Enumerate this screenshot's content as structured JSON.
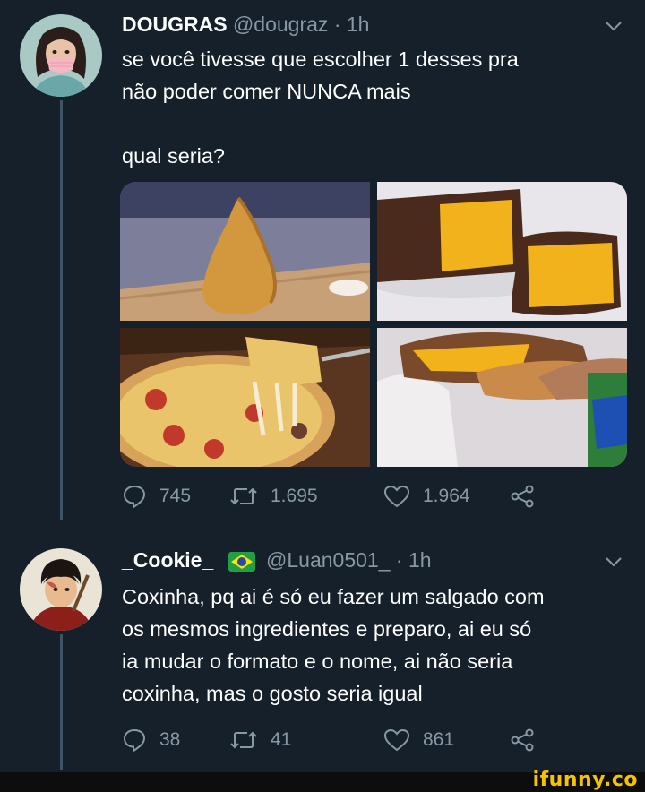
{
  "tweet1": {
    "name": "DOUGRAS",
    "handle": "@dougraz",
    "time": "· 1h",
    "lines": [
      "se você tivesse que escolher 1 desses pra",
      "não poder comer NUNCA mais",
      "",
      "qual seria?"
    ],
    "stats": {
      "replies": "745",
      "retweets": "1.695",
      "likes": "1.964"
    }
  },
  "tweet2": {
    "name": "_Cookie_",
    "handle": "@Luan0501_",
    "time": "· 1h",
    "flag": "brazil-flag",
    "lines": [
      "Coxinha, pq ai é só eu fazer um salgado com",
      "os mesmos ingredientes e preparo, ai eu só",
      "ia mudar o formato e o nome, ai não seria",
      "coxinha, mas o gosto seria igual"
    ],
    "stats": {
      "replies": "38",
      "retweets": "41",
      "likes": "861"
    }
  },
  "watermark": "ifunny.co",
  "colors": {
    "background": "#15202b",
    "muted": "#8899a6",
    "watermark": "#f5c400"
  }
}
